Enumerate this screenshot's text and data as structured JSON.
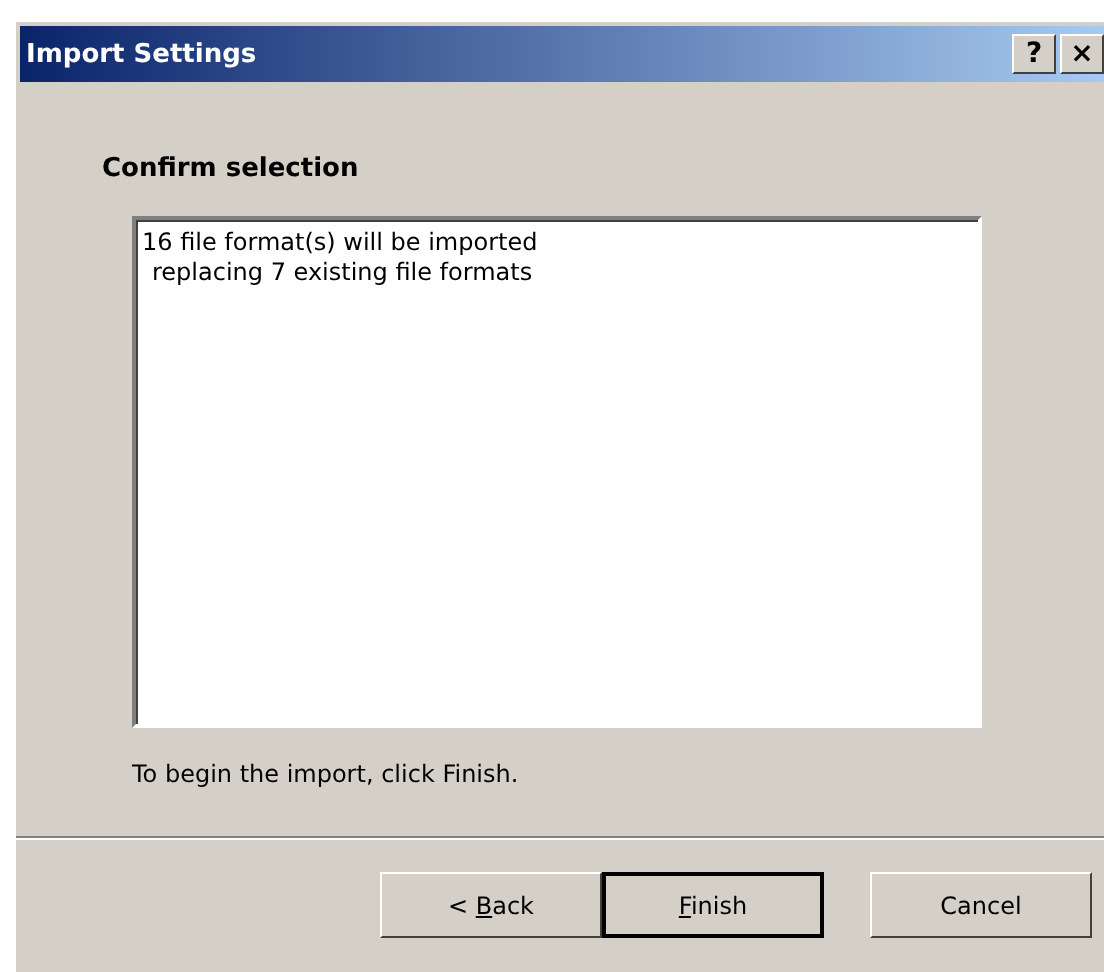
{
  "window": {
    "title": "Import Settings",
    "help_button": "?",
    "close_button": "×"
  },
  "heading": "Confirm selection",
  "summary_lines": [
    {
      "text": "16 file format(s) will be imported",
      "indented": false
    },
    {
      "text": "replacing 7 existing file formats",
      "indented": true
    }
  ],
  "instruction": "To begin the import, click Finish.",
  "buttons": [
    {
      "before": "< ",
      "access_key": "B",
      "after": "ack",
      "default": false
    },
    {
      "access_key": "F",
      "after": "inish",
      "default": true
    },
    {
      "before": "Cancel",
      "default": false
    }
  ]
}
